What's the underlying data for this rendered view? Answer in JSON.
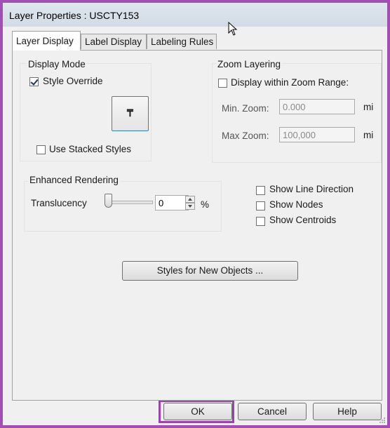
{
  "window": {
    "title": "Layer Properties  : USCTY153"
  },
  "tabs": [
    {
      "label": "Layer Display",
      "active": true
    },
    {
      "label": "Label Display",
      "active": false
    },
    {
      "label": "Labeling Rules",
      "active": false
    }
  ],
  "display_mode": {
    "title": "Display Mode",
    "style_override_label": "Style Override",
    "style_override_checked": true,
    "style_button_glyph": "₸",
    "use_stacked_styles_label": "Use Stacked Styles",
    "use_stacked_styles_checked": false
  },
  "zoom_layering": {
    "title": "Zoom Layering",
    "display_within_label": "Display within Zoom Range:",
    "display_within_checked": false,
    "min_label": "Min. Zoom:",
    "min_value": "0.000",
    "max_label": "Max Zoom:",
    "max_value": "100,000",
    "unit": "mi"
  },
  "enhanced_rendering": {
    "title": "Enhanced Rendering",
    "translucency_label": "Translucency",
    "translucency_value": "0",
    "unit": "%"
  },
  "options": [
    {
      "label": "Show Line Direction",
      "checked": false
    },
    {
      "label": "Show Nodes",
      "checked": false
    },
    {
      "label": "Show Centroids",
      "checked": false
    }
  ],
  "styles_button_label": "Styles for New Objects ...",
  "footer": {
    "ok_label": "OK",
    "cancel_label": "Cancel",
    "help_label": "Help"
  },
  "colors": {
    "highlight": "#9c44ad",
    "frame": "#a24fb2"
  }
}
